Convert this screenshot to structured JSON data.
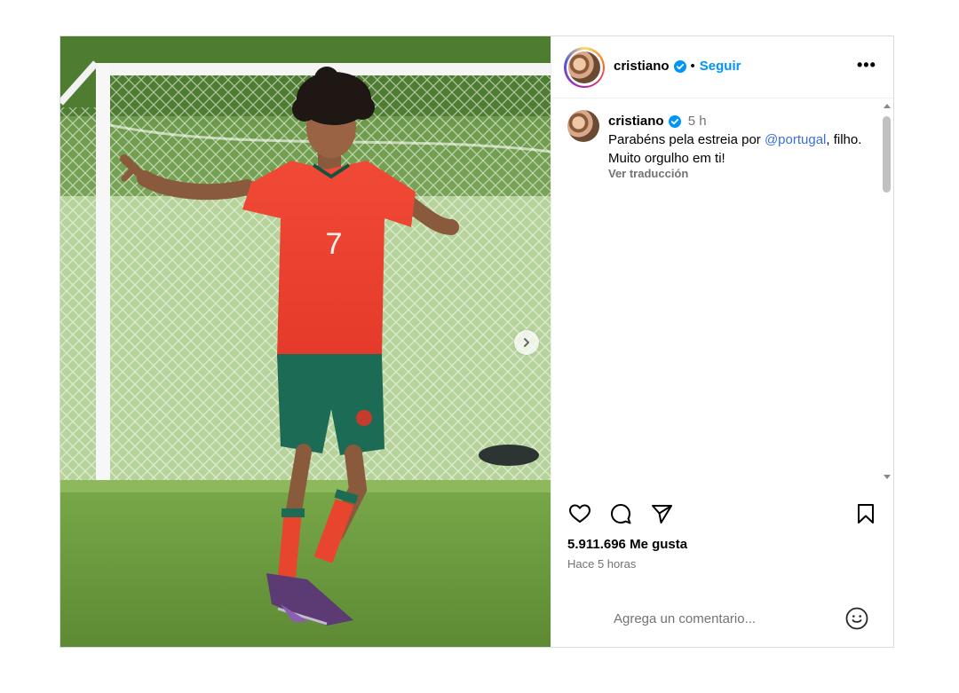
{
  "post": {
    "username": "cristiano",
    "dot": "•",
    "follow_label": "Seguir",
    "more_label": "•••",
    "caption": {
      "username": "cristiano",
      "time": "5 h",
      "text_before": "Parabéns pela estreia por ",
      "mention": "@portugal",
      "text_after": ", filho. Muito orgulho em ti!",
      "translate_label": "Ver traducción"
    },
    "photo": {
      "jersey_number": "7"
    },
    "likes": "5.911.696 Me gusta",
    "time_ago": "Hace 5 horas",
    "comment_placeholder": "Agrega un comentario..."
  },
  "icons": {
    "verified": "verified-badge-icon",
    "like": "heart-icon",
    "comment": "comment-bubble-icon",
    "share": "paper-plane-icon",
    "save": "bookmark-icon",
    "emoji": "smiley-icon",
    "next": "chevron-right-icon"
  },
  "colors": {
    "accent": "#0095f6",
    "verified": "#0095f6",
    "mention": "#3a6fd8",
    "secondary_text": "#737373",
    "border": "#dbdbdb"
  }
}
